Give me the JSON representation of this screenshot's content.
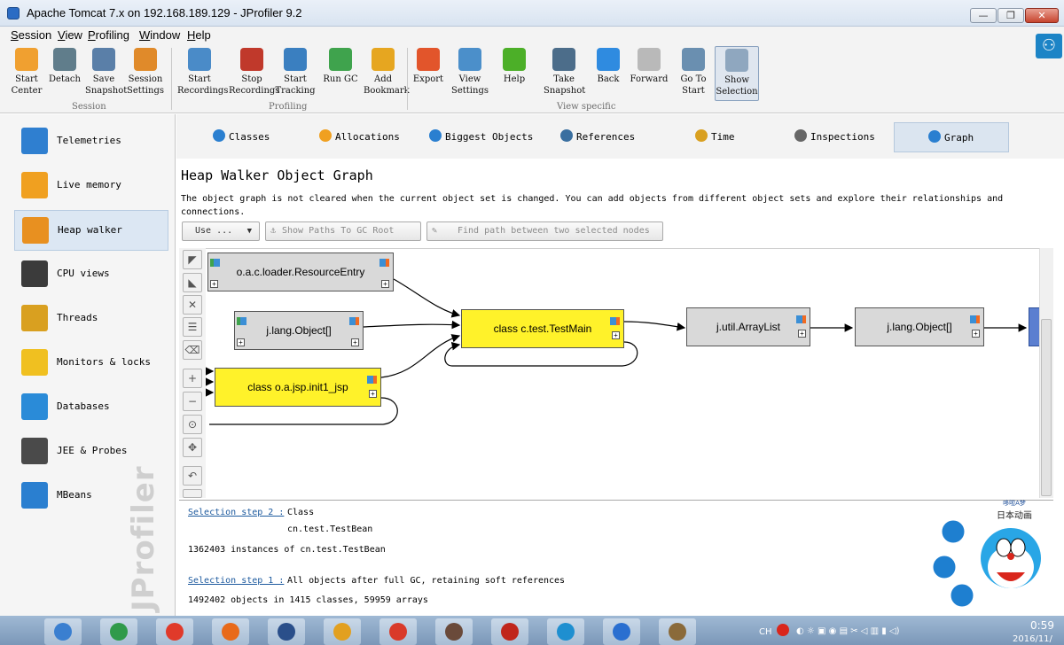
{
  "window": {
    "title": "Apache Tomcat 7.x on 192.168.189.129 - JProfiler 9.2",
    "min": "—",
    "max": "❐",
    "close": "✕"
  },
  "menu": [
    "Session",
    "View",
    "Profiling",
    "Window",
    "Help"
  ],
  "toolbar": {
    "buttons": [
      {
        "l1": "Start",
        "l2": "Center",
        "icon": "start-center-icon",
        "color": "#f0a030"
      },
      {
        "l1": "Detach",
        "l2": "",
        "icon": "detach-icon",
        "color": "#607d8b"
      },
      {
        "l1": "Save",
        "l2": "Snapshot",
        "icon": "save-snapshot-icon",
        "color": "#5a7fa8"
      },
      {
        "l1": "Session",
        "l2": "Settings",
        "icon": "session-settings-icon",
        "color": "#e08a2a"
      },
      {
        "l1": "Start",
        "l2": "Recordings",
        "icon": "start-recordings-icon",
        "color": "#4a8bc8"
      },
      {
        "l1": "Stop",
        "l2": "Recordings",
        "icon": "stop-recordings-icon",
        "color": "#c0392b"
      },
      {
        "l1": "Start",
        "l2": "Tracking",
        "icon": "start-tracking-icon",
        "color": "#3a7fc0"
      },
      {
        "l1": "Run GC",
        "l2": "",
        "icon": "run-gc-icon",
        "color": "#3fa34d"
      },
      {
        "l1": "Add",
        "l2": "Bookmark",
        "icon": "add-bookmark-icon",
        "color": "#e6a620"
      },
      {
        "l1": "Export",
        "l2": "",
        "icon": "export-icon",
        "color": "#e2552b"
      },
      {
        "l1": "View",
        "l2": "Settings",
        "icon": "view-settings-icon",
        "color": "#4b8fca"
      },
      {
        "l1": "Help",
        "l2": "",
        "icon": "help-icon",
        "color": "#4caf28"
      },
      {
        "l1": "Take",
        "l2": "Snapshot",
        "icon": "take-snapshot-icon",
        "color": "#4c6d8a"
      },
      {
        "l1": "Back",
        "l2": "",
        "icon": "back-icon",
        "color": "#2f8be0"
      },
      {
        "l1": "Forward",
        "l2": "",
        "icon": "forward-icon",
        "color": "#b9b9b9"
      },
      {
        "l1": "Go To",
        "l2": "Start",
        "icon": "go-to-start-icon",
        "color": "#6a8fb0"
      },
      {
        "l1": "Show",
        "l2": "Selection",
        "icon": "show-selection-icon",
        "color": "#8fa7bf"
      }
    ],
    "groups": [
      "Session",
      "Profiling",
      "View specific"
    ]
  },
  "sidebar": [
    {
      "label": "Telemetries",
      "icon": "telemetries-icon",
      "color": "#2f7fd0"
    },
    {
      "label": "Live memory",
      "icon": "live-memory-icon",
      "color": "#f0a020"
    },
    {
      "label": "Heap walker",
      "icon": "heap-walker-icon",
      "color": "#e89020"
    },
    {
      "label": "CPU views",
      "icon": "cpu-views-icon",
      "color": "#3b3b3b"
    },
    {
      "label": "Threads",
      "icon": "threads-icon",
      "color": "#d9a020"
    },
    {
      "label": "Monitors & locks",
      "icon": "monitors-locks-icon",
      "color": "#f0c020"
    },
    {
      "label": "Databases",
      "icon": "databases-icon",
      "color": "#2a8bd8"
    },
    {
      "label": "JEE & Probes",
      "icon": "jee-probes-icon",
      "color": "#4a4a4a"
    },
    {
      "label": "MBeans",
      "icon": "mbeans-icon",
      "color": "#2a7fd0"
    }
  ],
  "watermark": "JProfiler",
  "tabs": [
    {
      "label": "Classes",
      "icon": "classes-icon",
      "color": "#2a7fd0"
    },
    {
      "label": "Allocations",
      "icon": "allocations-icon",
      "color": "#f0a020"
    },
    {
      "label": "Biggest Objects",
      "icon": "biggest-objects-icon",
      "color": "#2a7fd0"
    },
    {
      "label": "References",
      "icon": "references-icon",
      "color": "#3a6fa0"
    },
    {
      "label": "Time",
      "icon": "time-icon",
      "color": "#d9a020"
    },
    {
      "label": "Inspections",
      "icon": "inspections-icon",
      "color": "#666666"
    },
    {
      "label": "Graph",
      "icon": "graph-icon",
      "color": "#2a7fd0"
    }
  ],
  "page": {
    "title": "Heap Walker Object Graph",
    "description": "The object graph is not cleared when the current object set is changed. You can add objects from different object sets and explore their relationships and connections.",
    "use_btn": "Use ...",
    "gc_btn": "Show Paths To GC Root",
    "path_btn": "Find path between two selected nodes"
  },
  "graph": {
    "nodes": [
      {
        "id": "n1",
        "label": "o.a.c.loader.ResourceEntry"
      },
      {
        "id": "n2",
        "label": "j.lang.Object[]"
      },
      {
        "id": "n3",
        "label": "class o.a.jsp.init1_jsp"
      },
      {
        "id": "n4",
        "label": "class c.test.TestMain"
      },
      {
        "id": "n5",
        "label": "j.util.ArrayList"
      },
      {
        "id": "n6",
        "label": "j.lang.Object[]"
      }
    ]
  },
  "info": {
    "step2_link": "Selection step 2 :",
    "step2_text": "Class",
    "step2_class": "cn.test.TestBean",
    "step2_count": "1362403 instances of cn.test.TestBean",
    "step1_link": "Selection step 1 :",
    "step1_text": "All objects after full GC, retaining soft references",
    "step1_count": "1492402 objects in 1415 classes, 59959 arrays"
  },
  "sticker": {
    "brand": "哆啦A梦",
    "sub": "日本动画"
  },
  "taskbar": {
    "apps": [
      "media-player",
      "chrome",
      "weibo",
      "firefox",
      "video-editor",
      "folder",
      "app-swirl",
      "photo",
      "filezilla",
      "baidu-cloud",
      "speedometer",
      "paint"
    ],
    "ime": "CH",
    "time": "0:59",
    "date": "2016/11/"
  }
}
